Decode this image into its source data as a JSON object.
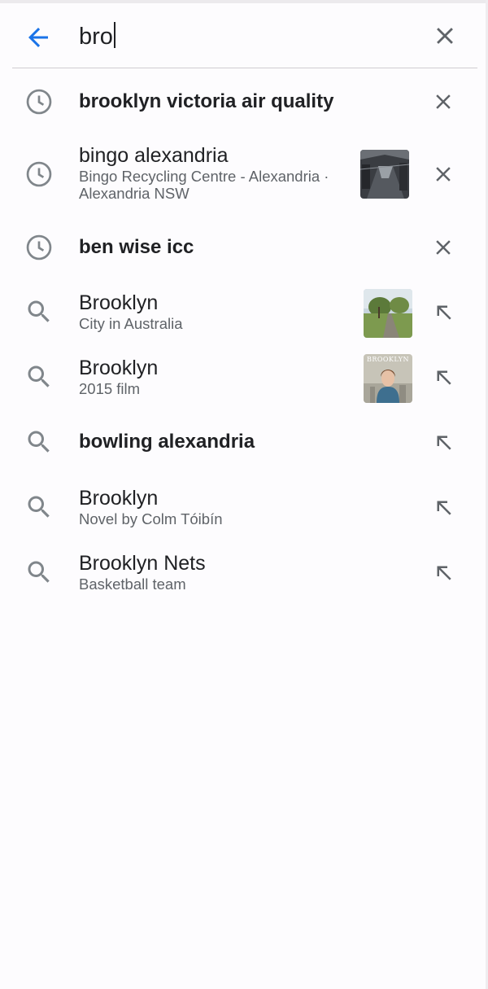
{
  "search": {
    "query": "bro"
  },
  "suggestions": [
    {
      "type": "history",
      "title": "brooklyn victoria air quality",
      "bold": true,
      "subtitle": "",
      "subtitle2": "",
      "thumbnail": "",
      "action": "remove"
    },
    {
      "type": "history",
      "title": "bingo alexandria",
      "bold": false,
      "subtitle": "Bingo Recycling Centre - Alexandria ·",
      "subtitle2": "Alexandria NSW",
      "thumbnail": "warehouse",
      "action": "remove"
    },
    {
      "type": "history",
      "title": "ben wise icc",
      "bold": true,
      "subtitle": "",
      "subtitle2": "",
      "thumbnail": "",
      "action": "remove"
    },
    {
      "type": "search",
      "title": "Brooklyn",
      "bold": false,
      "subtitle": "City in Australia",
      "subtitle2": "",
      "thumbnail": "road",
      "action": "fill"
    },
    {
      "type": "search",
      "title": "Brooklyn",
      "bold": false,
      "subtitle": "2015 film",
      "subtitle2": "",
      "thumbnail": "poster",
      "action": "fill"
    },
    {
      "type": "search",
      "title": "bowling alexandria",
      "bold": true,
      "subtitle": "",
      "subtitle2": "",
      "thumbnail": "",
      "action": "fill"
    },
    {
      "type": "search",
      "title": "Brooklyn",
      "bold": false,
      "subtitle": "Novel by Colm Tóibín",
      "subtitle2": "",
      "thumbnail": "",
      "action": "fill"
    },
    {
      "type": "search",
      "title": "Brooklyn Nets",
      "bold": false,
      "subtitle": "Basketball team",
      "subtitle2": "",
      "thumbnail": "",
      "action": "fill"
    }
  ],
  "thumbnails": {
    "poster_text": "BROOKLYN"
  },
  "colors": {
    "accent": "#1a73e8",
    "icon_gray": "#80868b",
    "action_gray": "#5f6368"
  },
  "icons": {
    "back": "arrow-back-icon",
    "clear": "close-icon",
    "history": "history-clock-icon",
    "search": "search-icon",
    "remove": "close-icon",
    "fill": "arrow-up-left-icon"
  }
}
